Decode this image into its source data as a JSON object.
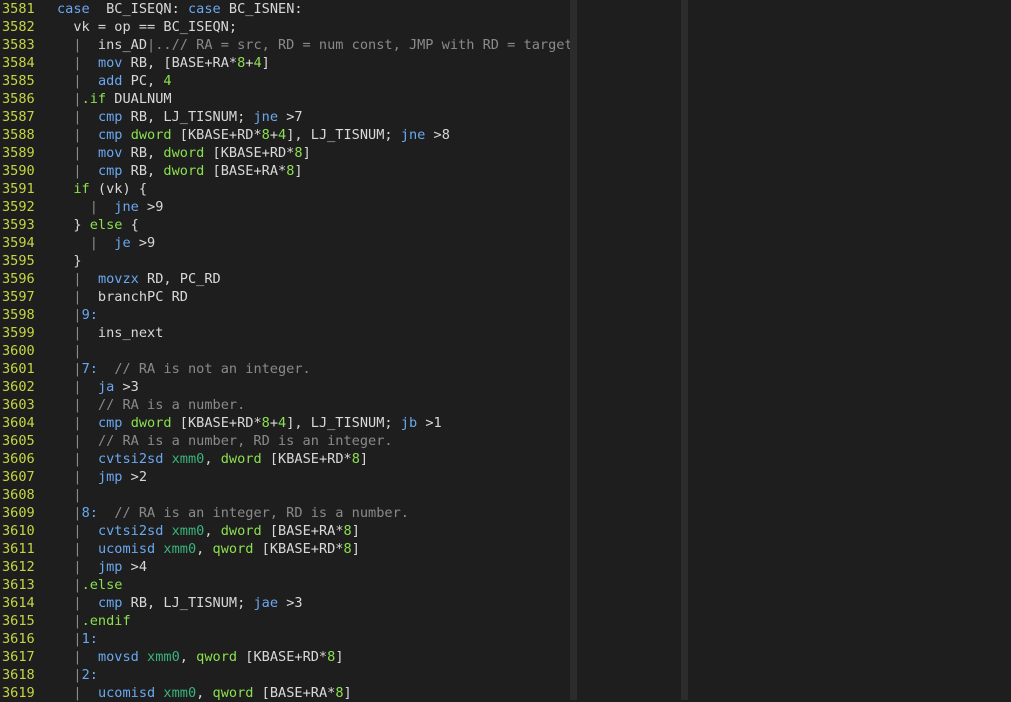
{
  "lines": [
    {
      "n": "3581",
      "t": [
        [
          "kw",
          "case"
        ],
        [
          "",
          "  BC_ISEQN: "
        ],
        [
          "kw",
          "case"
        ],
        [
          "",
          " BC_ISNEN:"
        ]
      ]
    },
    {
      "n": "3582",
      "t": [
        [
          "",
          "  vk = op == BC_ISEQN;"
        ]
      ]
    },
    {
      "n": "3583",
      "t": [
        [
          "pipe",
          "  |"
        ],
        [
          "",
          "  ins_AD"
        ],
        [
          "cm",
          "|..// RA = src, RD = num const, JMP with RD = target"
        ]
      ]
    },
    {
      "n": "3584",
      "t": [
        [
          "pipe",
          "  |"
        ],
        [
          "",
          "  "
        ],
        [
          "ins",
          "mov"
        ],
        [
          "",
          " RB, [BASE+RA*"
        ],
        [
          "num",
          "8"
        ],
        [
          "",
          "+"
        ],
        [
          "num",
          "4"
        ],
        [
          "",
          "]"
        ]
      ]
    },
    {
      "n": "3585",
      "t": [
        [
          "pipe",
          "  |"
        ],
        [
          "",
          "  "
        ],
        [
          "ins",
          "add"
        ],
        [
          "",
          " PC, "
        ],
        [
          "num",
          "4"
        ]
      ]
    },
    {
      "n": "3586",
      "t": [
        [
          "pipe",
          "  |"
        ],
        [
          "dir",
          ".if"
        ],
        [
          "",
          " DUALNUM"
        ]
      ]
    },
    {
      "n": "3587",
      "t": [
        [
          "pipe",
          "  |"
        ],
        [
          "",
          "  "
        ],
        [
          "ins",
          "cmp"
        ],
        [
          "",
          " RB, LJ_TISNUM; "
        ],
        [
          "ins",
          "jne"
        ],
        [
          "",
          " >7"
        ]
      ]
    },
    {
      "n": "3588",
      "t": [
        [
          "pipe",
          "  |"
        ],
        [
          "",
          "  "
        ],
        [
          "ins",
          "cmp"
        ],
        [
          "",
          " "
        ],
        [
          "dir",
          "dword"
        ],
        [
          "",
          " [KBASE+RD*"
        ],
        [
          "num",
          "8"
        ],
        [
          "",
          "+"
        ],
        [
          "num",
          "4"
        ],
        [
          "",
          "], LJ_TISNUM; "
        ],
        [
          "ins",
          "jne"
        ],
        [
          "",
          " >8"
        ]
      ]
    },
    {
      "n": "3589",
      "t": [
        [
          "pipe",
          "  |"
        ],
        [
          "",
          "  "
        ],
        [
          "ins",
          "mov"
        ],
        [
          "",
          " RB, "
        ],
        [
          "dir",
          "dword"
        ],
        [
          "",
          " [KBASE+RD*"
        ],
        [
          "num",
          "8"
        ],
        [
          "",
          "]"
        ]
      ]
    },
    {
      "n": "3590",
      "t": [
        [
          "pipe",
          "  |"
        ],
        [
          "",
          "  "
        ],
        [
          "ins",
          "cmp"
        ],
        [
          "",
          " RB, "
        ],
        [
          "dir",
          "dword"
        ],
        [
          "",
          " [BASE+RA*"
        ],
        [
          "num",
          "8"
        ],
        [
          "",
          "]"
        ]
      ]
    },
    {
      "n": "3591",
      "t": [
        [
          "",
          "  "
        ],
        [
          "dir",
          "if"
        ],
        [
          "",
          " (vk) {"
        ]
      ]
    },
    {
      "n": "3592",
      "t": [
        [
          "pipe",
          "    |"
        ],
        [
          "",
          "  "
        ],
        [
          "ins",
          "jne"
        ],
        [
          "",
          " >9"
        ]
      ]
    },
    {
      "n": "3593",
      "t": [
        [
          "",
          "  } "
        ],
        [
          "dir",
          "else"
        ],
        [
          "",
          " {"
        ]
      ]
    },
    {
      "n": "3594",
      "t": [
        [
          "pipe",
          "    |"
        ],
        [
          "",
          "  "
        ],
        [
          "ins",
          "je"
        ],
        [
          "",
          " >9"
        ]
      ]
    },
    {
      "n": "3595",
      "t": [
        [
          "",
          "  }"
        ]
      ]
    },
    {
      "n": "3596",
      "t": [
        [
          "pipe",
          "  |"
        ],
        [
          "",
          "  "
        ],
        [
          "ins",
          "movzx"
        ],
        [
          "",
          " RD, PC_RD"
        ]
      ]
    },
    {
      "n": "3597",
      "t": [
        [
          "pipe",
          "  |"
        ],
        [
          "",
          "  branchPC RD"
        ]
      ]
    },
    {
      "n": "3598",
      "t": [
        [
          "pipe",
          "  |"
        ],
        [
          "kw",
          "9:"
        ]
      ]
    },
    {
      "n": "3599",
      "t": [
        [
          "pipe",
          "  |"
        ],
        [
          "",
          "  ins_next"
        ]
      ]
    },
    {
      "n": "3600",
      "t": [
        [
          "pipe",
          "  |"
        ]
      ]
    },
    {
      "n": "3601",
      "t": [
        [
          "pipe",
          "  |"
        ],
        [
          "kw",
          "7:"
        ],
        [
          "",
          "  "
        ],
        [
          "cm",
          "// RA is not an integer."
        ]
      ]
    },
    {
      "n": "3602",
      "t": [
        [
          "pipe",
          "  |"
        ],
        [
          "",
          "  "
        ],
        [
          "ins",
          "ja"
        ],
        [
          "",
          " >3"
        ]
      ]
    },
    {
      "n": "3603",
      "t": [
        [
          "pipe",
          "  |"
        ],
        [
          "",
          "  "
        ],
        [
          "cm",
          "// RA is a number."
        ]
      ]
    },
    {
      "n": "3604",
      "t": [
        [
          "pipe",
          "  |"
        ],
        [
          "",
          "  "
        ],
        [
          "ins",
          "cmp"
        ],
        [
          "",
          " "
        ],
        [
          "dir",
          "dword"
        ],
        [
          "",
          " [KBASE+RD*"
        ],
        [
          "num",
          "8"
        ],
        [
          "",
          "+"
        ],
        [
          "num",
          "4"
        ],
        [
          "",
          "], LJ_TISNUM; "
        ],
        [
          "ins",
          "jb"
        ],
        [
          "",
          " >1"
        ]
      ]
    },
    {
      "n": "3605",
      "t": [
        [
          "pipe",
          "  |"
        ],
        [
          "",
          "  "
        ],
        [
          "cm",
          "// RA is a number, RD is an integer."
        ]
      ]
    },
    {
      "n": "3606",
      "t": [
        [
          "pipe",
          "  |"
        ],
        [
          "",
          "  "
        ],
        [
          "ins",
          "cvtsi2sd"
        ],
        [
          "",
          " "
        ],
        [
          "reg",
          "xmm0"
        ],
        [
          "",
          ", "
        ],
        [
          "dir",
          "dword"
        ],
        [
          "",
          " [KBASE+RD*"
        ],
        [
          "num",
          "8"
        ],
        [
          "",
          "]"
        ]
      ]
    },
    {
      "n": "3607",
      "t": [
        [
          "pipe",
          "  |"
        ],
        [
          "",
          "  "
        ],
        [
          "ins",
          "jmp"
        ],
        [
          "",
          " >2"
        ]
      ]
    },
    {
      "n": "3608",
      "t": [
        [
          "pipe",
          "  |"
        ]
      ]
    },
    {
      "n": "3609",
      "t": [
        [
          "pipe",
          "  |"
        ],
        [
          "kw",
          "8:"
        ],
        [
          "",
          "  "
        ],
        [
          "cm",
          "// RA is an integer, RD is a number."
        ]
      ]
    },
    {
      "n": "3610",
      "t": [
        [
          "pipe",
          "  |"
        ],
        [
          "",
          "  "
        ],
        [
          "ins",
          "cvtsi2sd"
        ],
        [
          "",
          " "
        ],
        [
          "reg",
          "xmm0"
        ],
        [
          "",
          ", "
        ],
        [
          "dir",
          "dword"
        ],
        [
          "",
          " [BASE+RA*"
        ],
        [
          "num",
          "8"
        ],
        [
          "",
          "]"
        ]
      ]
    },
    {
      "n": "3611",
      "t": [
        [
          "pipe",
          "  |"
        ],
        [
          "",
          "  "
        ],
        [
          "ins",
          "ucomisd"
        ],
        [
          "",
          " "
        ],
        [
          "reg",
          "xmm0"
        ],
        [
          "",
          ", "
        ],
        [
          "dir",
          "qword"
        ],
        [
          "",
          " [KBASE+RD*"
        ],
        [
          "num",
          "8"
        ],
        [
          "",
          "]"
        ]
      ]
    },
    {
      "n": "3612",
      "t": [
        [
          "pipe",
          "  |"
        ],
        [
          "",
          "  "
        ],
        [
          "ins",
          "jmp"
        ],
        [
          "",
          " >4"
        ]
      ]
    },
    {
      "n": "3613",
      "t": [
        [
          "pipe",
          "  |"
        ],
        [
          "dir",
          ".else"
        ]
      ]
    },
    {
      "n": "3614",
      "t": [
        [
          "pipe",
          "  |"
        ],
        [
          "",
          "  "
        ],
        [
          "ins",
          "cmp"
        ],
        [
          "",
          " RB, LJ_TISNUM; "
        ],
        [
          "ins",
          "jae"
        ],
        [
          "",
          " >3"
        ]
      ]
    },
    {
      "n": "3615",
      "t": [
        [
          "pipe",
          "  |"
        ],
        [
          "dir",
          ".endif"
        ]
      ]
    },
    {
      "n": "3616",
      "t": [
        [
          "pipe",
          "  |"
        ],
        [
          "kw",
          "1:"
        ]
      ]
    },
    {
      "n": "3617",
      "t": [
        [
          "pipe",
          "  |"
        ],
        [
          "",
          "  "
        ],
        [
          "ins",
          "movsd"
        ],
        [
          "",
          " "
        ],
        [
          "reg",
          "xmm0"
        ],
        [
          "",
          ", "
        ],
        [
          "dir",
          "qword"
        ],
        [
          "",
          " [KBASE+RD*"
        ],
        [
          "num",
          "8"
        ],
        [
          "",
          "]"
        ]
      ]
    },
    {
      "n": "3618",
      "t": [
        [
          "pipe",
          "  |"
        ],
        [
          "kw",
          "2:"
        ]
      ]
    },
    {
      "n": "3619",
      "t": [
        [
          "pipe",
          "  |"
        ],
        [
          "",
          "  "
        ],
        [
          "ins",
          "ucomisd"
        ],
        [
          "",
          " "
        ],
        [
          "reg",
          "xmm0"
        ],
        [
          "",
          ", "
        ],
        [
          "dir",
          "qword"
        ],
        [
          "",
          " [BASE+RA*"
        ],
        [
          "num",
          "8"
        ],
        [
          "",
          "]"
        ]
      ]
    }
  ]
}
